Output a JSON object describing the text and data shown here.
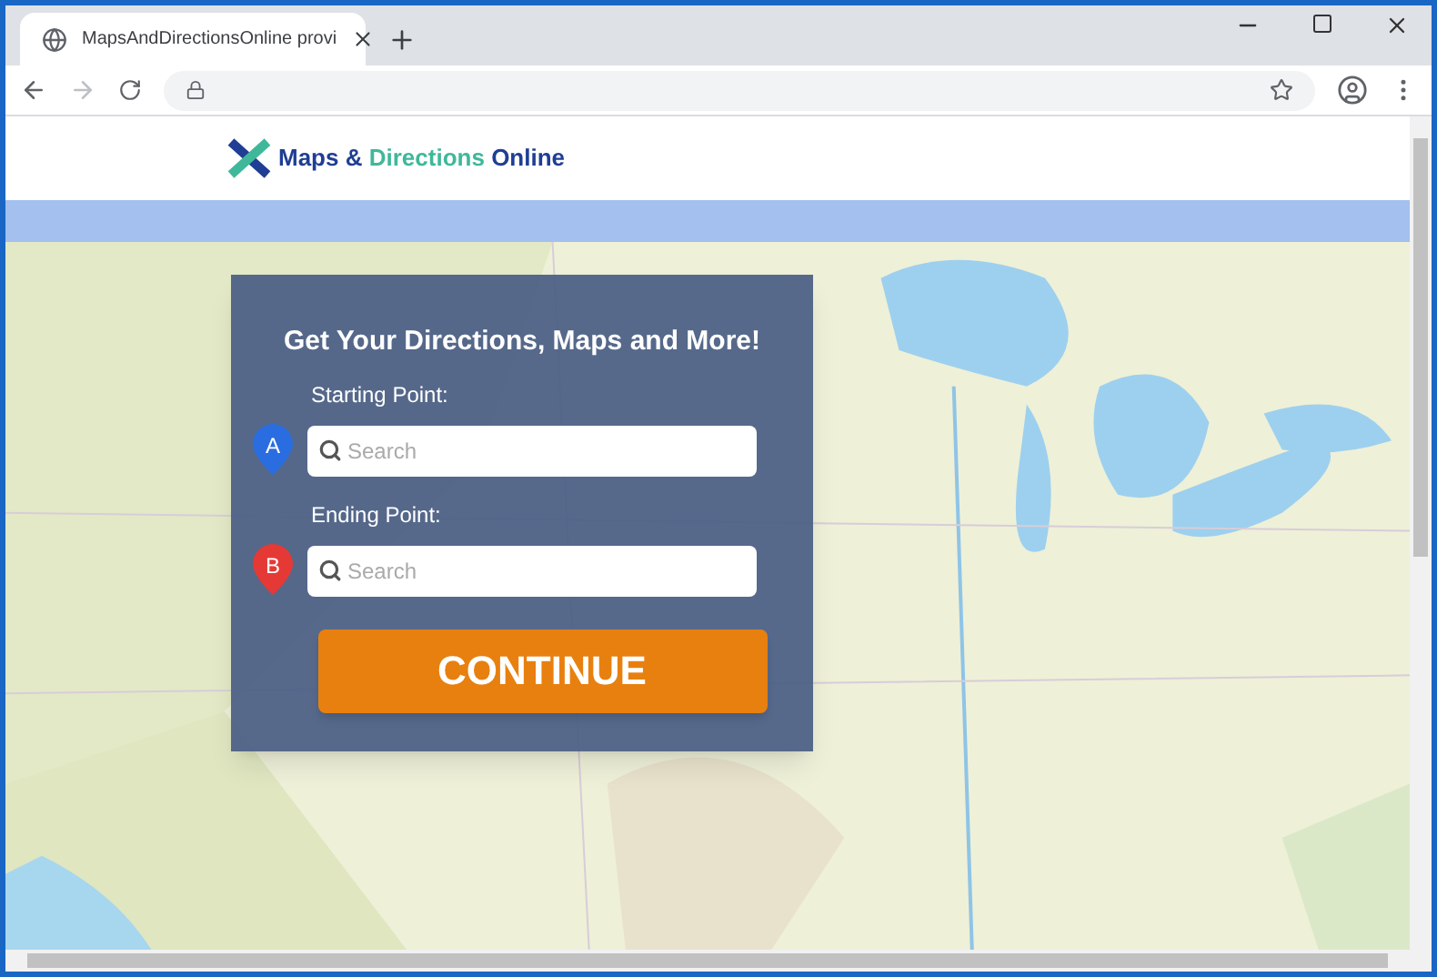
{
  "browser": {
    "tab": {
      "title": "MapsAndDirectionsOnline provi",
      "selected": true
    }
  },
  "logo": {
    "parts": [
      "Maps &",
      "Directions",
      "Online"
    ]
  },
  "form": {
    "heading": "Get Your Directions, Maps and More!",
    "fields": [
      {
        "label": "Starting Point:",
        "marker": "A",
        "color": "#2a6de0",
        "placeholder": "Search"
      },
      {
        "label": "Ending Point:",
        "marker": "B",
        "color": "#e53935",
        "placeholder": "Search"
      }
    ],
    "button": "CONTINUE"
  }
}
